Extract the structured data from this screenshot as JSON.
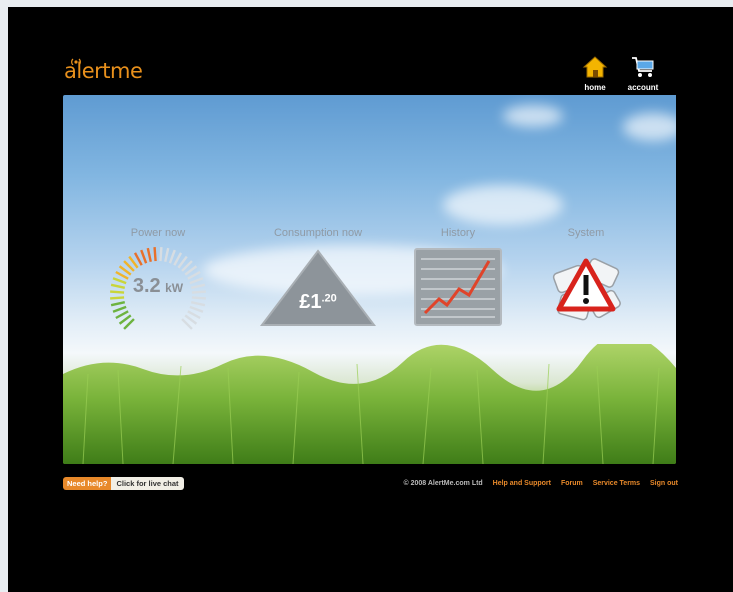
{
  "brand": {
    "logo_text": "alertme",
    "color": "#e8901c"
  },
  "nav": [
    {
      "label": "home",
      "icon": "home-icon"
    },
    {
      "label": "account",
      "icon": "cart-icon"
    }
  ],
  "panels": {
    "power": {
      "title": "Power now",
      "value": "3.2",
      "unit": "kW",
      "icon": "power-gauge-icon"
    },
    "consumption": {
      "title": "Consumption now",
      "currency": "£1",
      "pence": ".20",
      "icon": "triangle-icon"
    },
    "history": {
      "title": "History",
      "icon": "history-chart-icon"
    },
    "system": {
      "title": "System",
      "icon": "warning-icon"
    }
  },
  "footer": {
    "help_label": "Need help?",
    "chat_label": "Click for live chat",
    "copyright": "© 2008 AlertMe.com Ltd",
    "links": [
      "Help and Support",
      "Forum",
      "Service Terms",
      "Sign out"
    ]
  },
  "colors": {
    "accent": "#e8892a",
    "background": "#000000"
  }
}
